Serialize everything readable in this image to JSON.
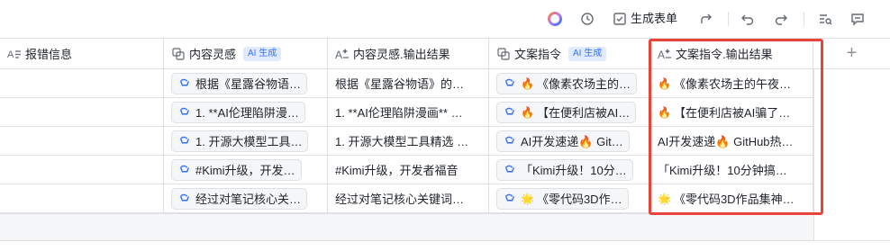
{
  "toolbar": {
    "generate_form_label": "生成表单"
  },
  "columns": [
    {
      "label": "报错信息",
      "icon": "text-field-icon",
      "ai": false
    },
    {
      "label": "内容灵感",
      "icon": "link-field-icon",
      "ai": true
    },
    {
      "label": "内容灵感.输出结果",
      "icon": "ai-text-field-icon",
      "ai": false
    },
    {
      "label": "文案指令",
      "icon": "link-field-icon",
      "ai": true
    },
    {
      "label": "文案指令.输出结果",
      "icon": "ai-text-field-icon",
      "ai": false
    }
  ],
  "ai_badge_label": "AI 生成",
  "add_column_label": "+",
  "rows": [
    {
      "inspiration": "根据《星露谷物语…",
      "inspiration_output": "根据《星露谷物语》的…",
      "copy": "《像素农场主的…",
      "copy_emoji": "🔥",
      "copy_output": "《像素农场主的午夜…",
      "copy_output_emoji": "🔥"
    },
    {
      "inspiration": "1. **AI伦理陷阱漫…",
      "inspiration_output": "1. **AI伦理陷阱漫画** …",
      "copy": "【在便利店被AI…",
      "copy_emoji": "🔥",
      "copy_output": "【在便利店被AI骗了…",
      "copy_output_emoji": "🔥"
    },
    {
      "inspiration": "1. 开源大模型工具…",
      "inspiration_output": "1. 开源大模型工具精选 …",
      "copy": "AI开发速递🔥 Git…",
      "copy_emoji": "",
      "copy_output": "AI开发速递🔥 GitHub热…",
      "copy_output_emoji": ""
    },
    {
      "inspiration": "#Kimi升级，开发…",
      "inspiration_output": "#Kimi升级，开发者福音",
      "copy": "「Kimi升级！10分…",
      "copy_emoji": "",
      "copy_output": "「Kimi升级！10分钟搞…",
      "copy_output_emoji": ""
    },
    {
      "inspiration": "经过对笔记核心关…",
      "inspiration_output": "经过对笔记核心关键词…",
      "copy": "《零代码3D作…",
      "copy_emoji": "🌟",
      "copy_output": "《零代码3D作品集神…",
      "copy_output_emoji": "🌟"
    }
  ]
}
